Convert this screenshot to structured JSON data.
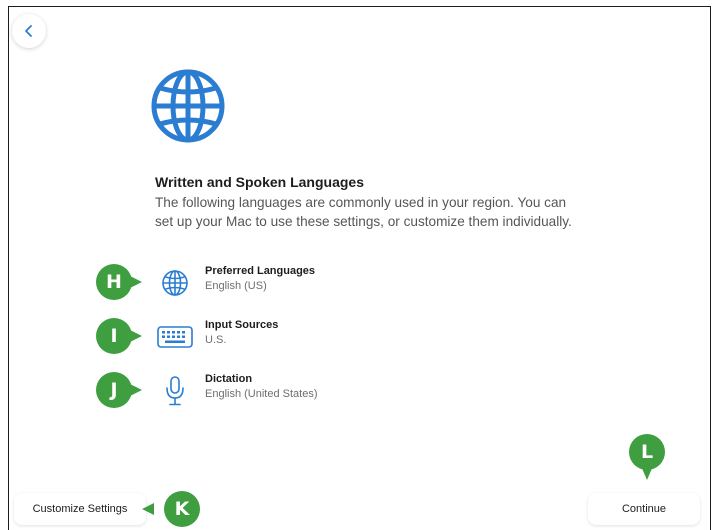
{
  "page": {
    "title": "Written and Spoken Languages",
    "description": "The following languages are commonly used in your region. You can set up your Mac to use these settings, or customize them individually."
  },
  "items": [
    {
      "label": "Preferred Languages",
      "value": "English (US)",
      "icon": "globe-icon",
      "callout": "H"
    },
    {
      "label": "Input Sources",
      "value": "U.S.",
      "icon": "keyboard-icon",
      "callout": "I"
    },
    {
      "label": "Dictation",
      "value": "English (United States)",
      "icon": "microphone-icon",
      "callout": "J"
    }
  ],
  "buttons": {
    "customize_label": "Customize Settings",
    "continue_label": "Continue"
  },
  "callouts": {
    "customize": "K",
    "continue": "L"
  },
  "colors": {
    "accent": "#2a7dd1",
    "callout": "#3f9e3f"
  }
}
